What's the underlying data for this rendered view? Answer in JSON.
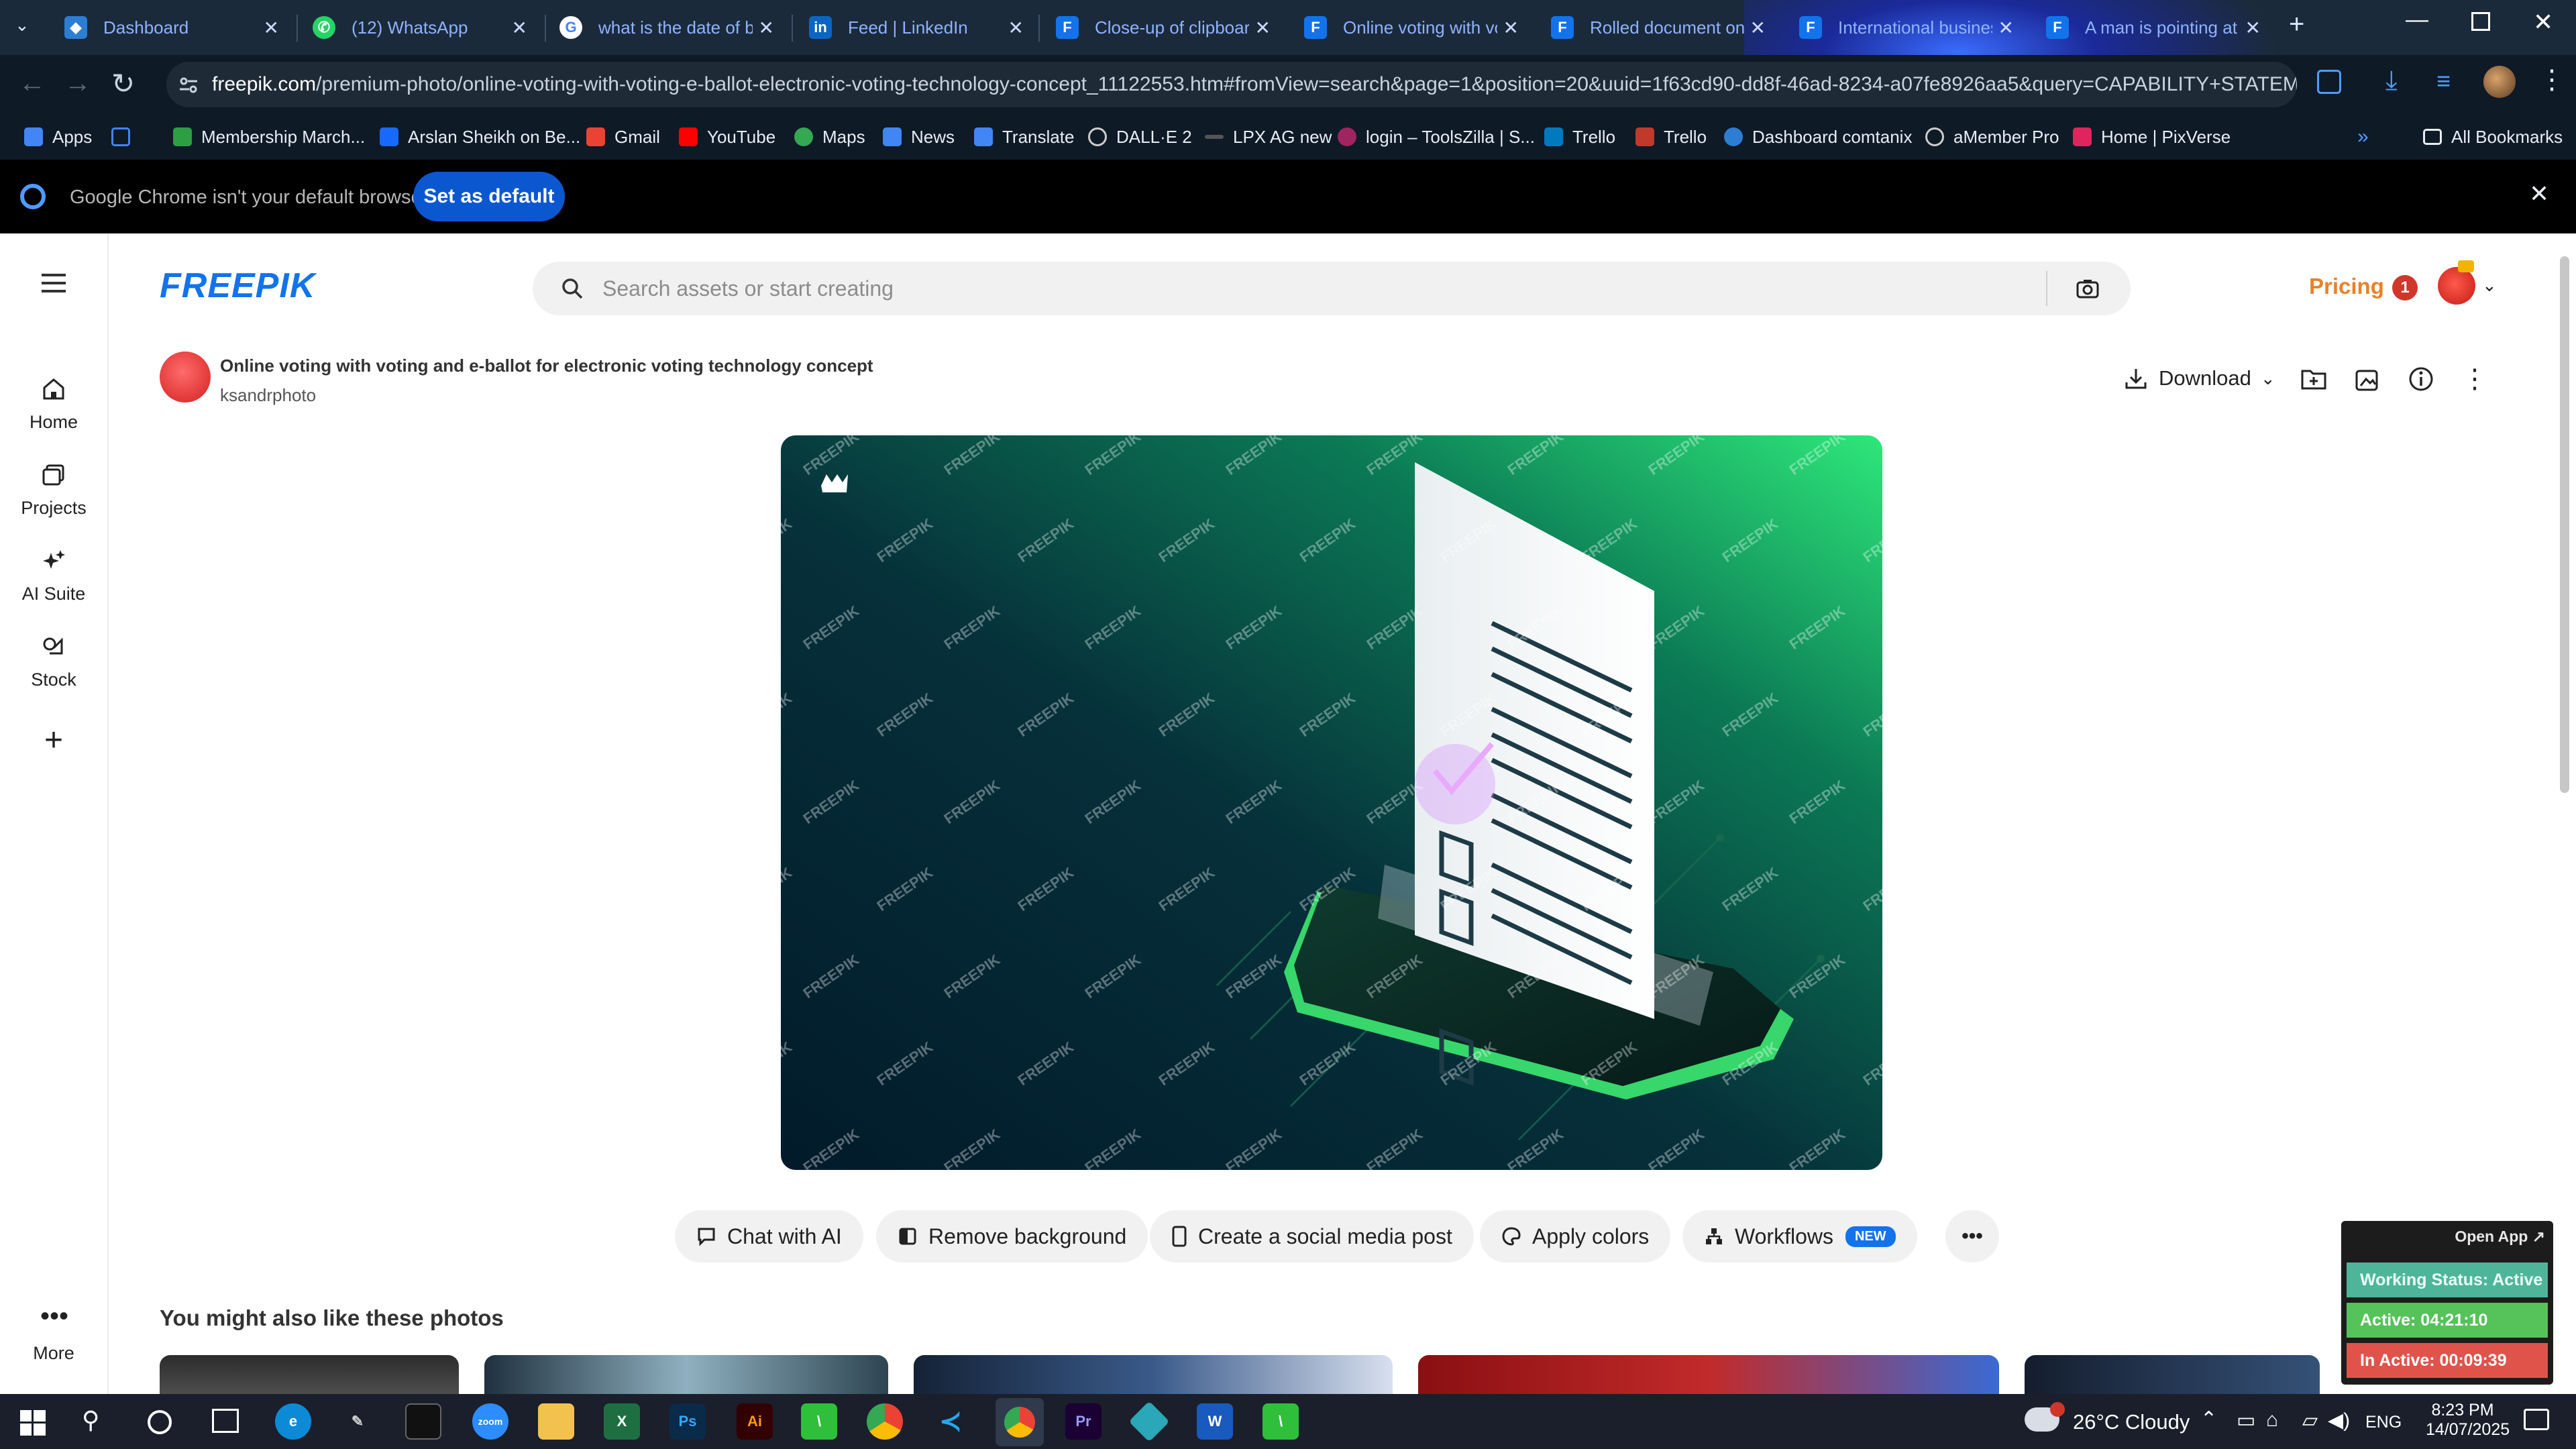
{
  "browser": {
    "tabs": [
      {
        "title": "Dashboard",
        "icon": "dashboard-icon",
        "color": "#2d7dd2"
      },
      {
        "title": "(12) WhatsApp",
        "icon": "whatsapp-icon",
        "color": "#25d366"
      },
      {
        "title": "what is the date of bi",
        "icon": "google-icon",
        "color": "#ffffff"
      },
      {
        "title": "Feed | LinkedIn",
        "icon": "linkedin-icon",
        "color": "#0a66c2"
      },
      {
        "title": "Close-up of clipboard",
        "icon": "freepik-icon",
        "color": "#1273eb"
      },
      {
        "title": "Online voting with vo",
        "icon": "freepik-icon",
        "color": "#1273eb"
      },
      {
        "title": "Rolled document on",
        "icon": "freepik-icon",
        "color": "#1273eb"
      },
      {
        "title": "International busines",
        "icon": "freepik-icon",
        "color": "#1273eb"
      },
      {
        "title": "A man is pointing at",
        "icon": "freepik-icon",
        "color": "#1273eb"
      }
    ],
    "url_host": "freepik.com",
    "url_path": "/premium-photo/online-voting-with-voting-e-ballot-electronic-voting-technology-concept_11122553.htm#fromView=search&page=1&position=20&uuid=1f63cd90-dd8f-46ad-8234-a07fe8926aa5&query=CAPABILITY+STATEMENT",
    "bookmarks": [
      {
        "label": "Apps",
        "color": "#4285f4"
      },
      {
        "label": "",
        "color": "#4285f4"
      },
      {
        "label": "Membership March...",
        "color": "#2e9e44"
      },
      {
        "label": "Arslan Sheikh on Be...",
        "color": "#1769ff"
      },
      {
        "label": "Gmail",
        "color": "#ea4335"
      },
      {
        "label": "YouTube",
        "color": "#ff0000"
      },
      {
        "label": "Maps",
        "color": "#34a853"
      },
      {
        "label": "News",
        "color": "#4285f4"
      },
      {
        "label": "Translate",
        "color": "#4285f4"
      },
      {
        "label": "DALL·E 2",
        "color": "#cccccc"
      },
      {
        "label": "LPX AG new",
        "color": "#666666"
      },
      {
        "label": "login – ToolsZilla | S...",
        "color": "#a0245f"
      },
      {
        "label": "Trello",
        "color": "#0079bf"
      },
      {
        "label": "Trello",
        "color": "#0079bf"
      },
      {
        "label": "Dashboard comtanix",
        "color": "#2d7dd2"
      },
      {
        "label": "aMember Pro",
        "color": "#cccccc"
      },
      {
        "label": "Home | PixVerse",
        "color": "#e0245e"
      }
    ],
    "all_bookmarks": "All Bookmarks",
    "infobar_text": "Google Chrome isn't your default browser",
    "set_default": "Set as default"
  },
  "site": {
    "logo": "FREEPIK",
    "search_placeholder": "Search assets or start creating",
    "pricing": "Pricing",
    "notification_count": "1",
    "nav": [
      {
        "label": "Home",
        "icon": "home-icon"
      },
      {
        "label": "Projects",
        "icon": "projects-icon"
      },
      {
        "label": "AI Suite",
        "icon": "ai-suite-icon"
      },
      {
        "label": "Stock",
        "icon": "stock-icon"
      },
      {
        "label": "",
        "icon": "plus-icon"
      },
      {
        "label": "More",
        "icon": "more-icon"
      }
    ],
    "asset_title": "Online voting with voting and e-ballot for electronic voting technology concept",
    "author": "ksandrphoto",
    "download": "Download",
    "watermark": "FREEPIK",
    "actions": [
      "Chat with AI",
      "Remove background",
      "Create a social media post",
      "Apply colors",
      "Workflows"
    ],
    "new_badge": "NEW",
    "related_heading": "You might also like these photos"
  },
  "widget": {
    "open_app": "Open App ↗",
    "status": "Working Status: Active",
    "active": "Active: 04:21:10",
    "inactive": "In Active: 00:09:39"
  },
  "taskbar": {
    "weather": "26°C  Cloudy",
    "lang": "ENG",
    "time": "8:23 PM",
    "date": "14/07/2025"
  }
}
